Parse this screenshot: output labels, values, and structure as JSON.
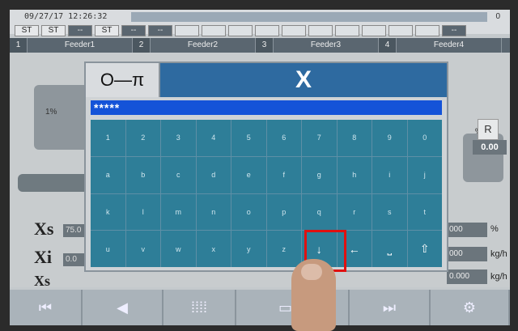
{
  "status": {
    "datetime": "09/27/17 12:26:32",
    "counter": "0",
    "indicators": [
      {
        "label": "ST",
        "style": "light"
      },
      {
        "label": "ST",
        "style": "light"
      },
      {
        "label": "--",
        "style": "dark"
      },
      {
        "label": "ST",
        "style": "light"
      },
      {
        "label": "--",
        "style": "dark"
      },
      {
        "label": "--",
        "style": "dark"
      },
      {
        "label": "",
        "style": "blank"
      },
      {
        "label": "",
        "style": "blank"
      },
      {
        "label": "",
        "style": "blank"
      },
      {
        "label": "",
        "style": "blank"
      },
      {
        "label": "",
        "style": "blank"
      },
      {
        "label": "",
        "style": "blank"
      },
      {
        "label": "",
        "style": "blank"
      },
      {
        "label": "",
        "style": "blank"
      },
      {
        "label": "",
        "style": "blank"
      },
      {
        "label": "",
        "style": "blank"
      },
      {
        "label": "--",
        "style": "dark"
      }
    ]
  },
  "feeders": [
    {
      "num": "1",
      "name": "Feeder1"
    },
    {
      "num": "2",
      "name": "Feeder2"
    },
    {
      "num": "3",
      "name": "Feeder3"
    },
    {
      "num": "4",
      "name": "Feeder4"
    }
  ],
  "main": {
    "feeder_pct": "1%",
    "pct_unit": "%",
    "zero_value": "0.00",
    "xs_label": "Xs",
    "xs_value": "75.0",
    "xi_label": "Xi",
    "xi_value": "0.0",
    "xs2_label": "Xs",
    "right_rows": [
      {
        "value": "000",
        "unit": "%"
      },
      {
        "value": "000",
        "unit": "kg/h"
      },
      {
        "value": "0.000",
        "unit": "kg/h"
      }
    ],
    "r_button": "R"
  },
  "keypad": {
    "key_icon": "O—π",
    "close_label": "X",
    "password_value": "*****",
    "keys": [
      "1",
      "2",
      "3",
      "4",
      "5",
      "6",
      "7",
      "8",
      "9",
      "0",
      "a",
      "b",
      "c",
      "d",
      "e",
      "f",
      "g",
      "h",
      "i",
      "j",
      "k",
      "l",
      "m",
      "n",
      "o",
      "p",
      "q",
      "r",
      "s",
      "t",
      "u",
      "v",
      "w",
      "x",
      "y",
      "z",
      "↓",
      "←",
      "⎵",
      "⇧"
    ]
  },
  "bottom": {
    "buttons": [
      "⏮",
      "◀",
      "⁞⁞⁞⁞",
      "▭▭",
      "⏭",
      "⚙"
    ]
  },
  "colors": {
    "accent": "#2e6aa0",
    "highlight": "#e01010",
    "input_bg": "#1453d8",
    "key_bg": "#2e7e98"
  }
}
